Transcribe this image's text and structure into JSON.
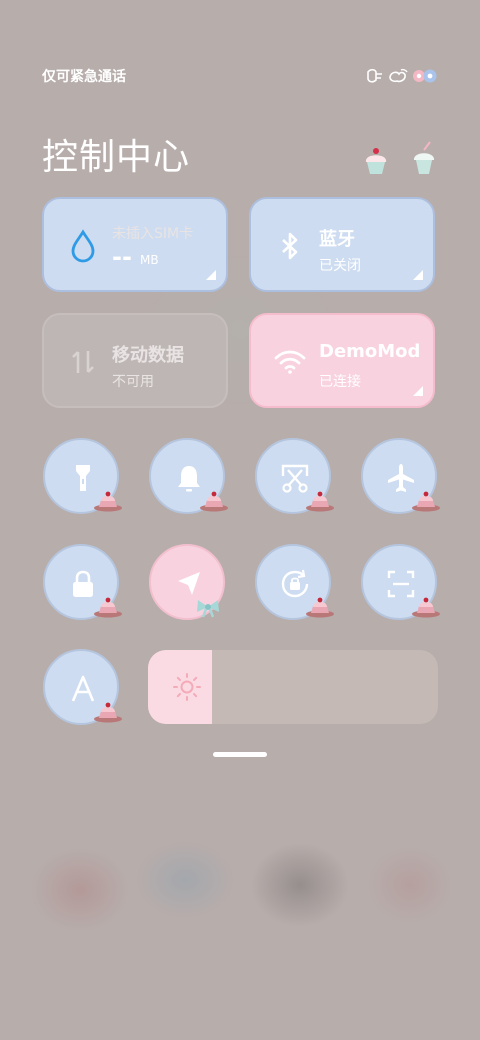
{
  "status_bar": {
    "carrier_text": "仅可紧急通话"
  },
  "header": {
    "title": "控制中心"
  },
  "tiles": {
    "data_usage": {
      "title": "未插入SIM卡",
      "value": "--",
      "unit": "MB"
    },
    "bluetooth": {
      "title": "蓝牙",
      "status": "已关闭"
    },
    "mobile_data": {
      "title": "移动数据",
      "status": "不可用"
    },
    "wifi": {
      "title": "DemoMod",
      "status": "已连接"
    }
  },
  "toggles": [
    {
      "icon": "flashlight-icon",
      "active": false
    },
    {
      "icon": "bell-icon",
      "active": false
    },
    {
      "icon": "screenshot-icon",
      "active": false
    },
    {
      "icon": "airplane-icon",
      "active": false
    },
    {
      "icon": "lock-icon",
      "active": false
    },
    {
      "icon": "location-icon",
      "active": true
    },
    {
      "icon": "rotation-lock-icon",
      "active": false
    },
    {
      "icon": "scan-icon",
      "active": false
    },
    {
      "icon": "font-icon",
      "active": false
    }
  ],
  "brightness": {
    "level_percent": 22
  },
  "colors": {
    "tile_blue": "#cddcf0",
    "tile_pink": "#f9d2df",
    "wifi_accent": "#f4bccd",
    "drop_blue": "#2f9be6"
  }
}
